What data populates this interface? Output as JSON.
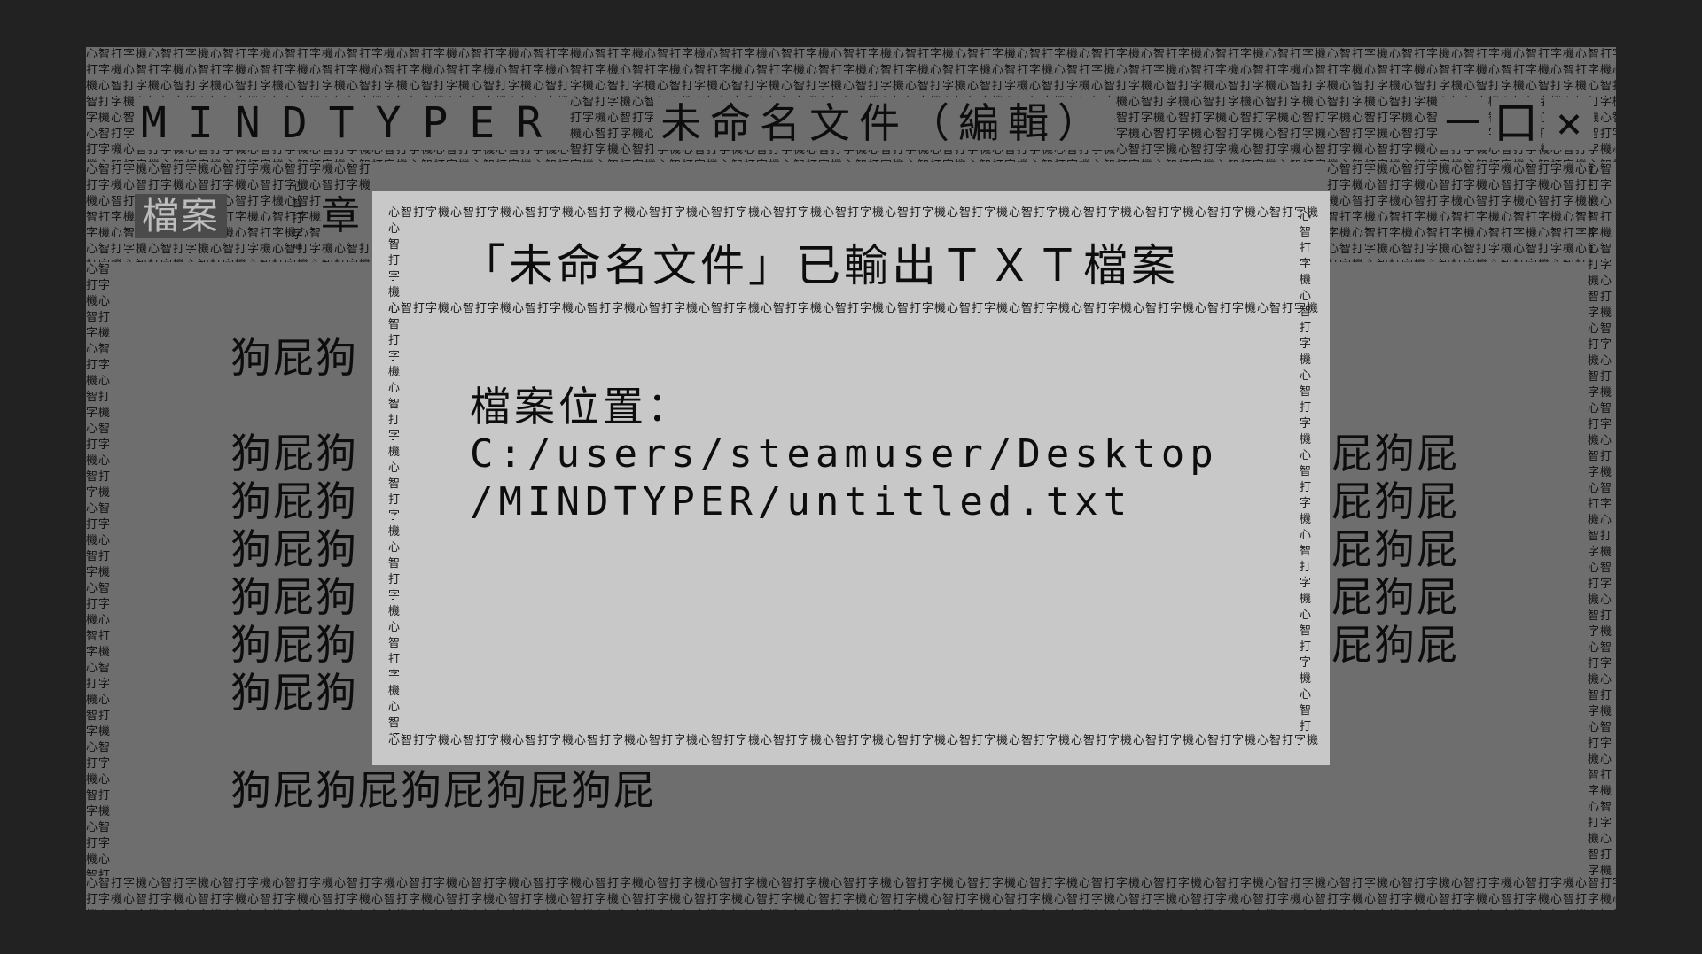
{
  "window": {
    "app_name": "MINDTYPER",
    "document_title": "未命名文件（編輯）",
    "controls": {
      "minimize": "－",
      "maximize": "口",
      "close": "×"
    },
    "border_pattern": "心智打字機"
  },
  "menu": {
    "file_label": "檔案",
    "chapter_label": "章"
  },
  "editor": {
    "lines": [
      {
        "left": "狗屁狗",
        "right": ""
      },
      {
        "left": "狗屁狗",
        "right": "屁狗屁"
      },
      {
        "left": "狗屁狗",
        "right": "屁狗屁"
      },
      {
        "left": "狗屁狗",
        "right": "屁狗屁"
      },
      {
        "left": "狗屁狗",
        "right": "屁狗屁"
      },
      {
        "left": "狗屁狗",
        "right": "屁狗屁"
      },
      {
        "left": "狗屁狗",
        "right": ""
      },
      {
        "left": "狗屁狗屁狗屁狗屁狗屁",
        "right": ""
      }
    ]
  },
  "dialog": {
    "title": "「未命名文件」已輸出ＴＸＴ檔案",
    "location_label": "檔案位置：",
    "path_line1": "C:/users/steamuser/Desktop",
    "path_line2": "/MINDTYPER/untitled.txt"
  },
  "colors": {
    "page_background": "#222222",
    "window_background": "#6e6e6e",
    "dialog_background": "#c8c8c8",
    "text": "#0d0d0d",
    "active_menu_background": "#4a4a4a",
    "active_menu_text": "#bdbdbd"
  }
}
